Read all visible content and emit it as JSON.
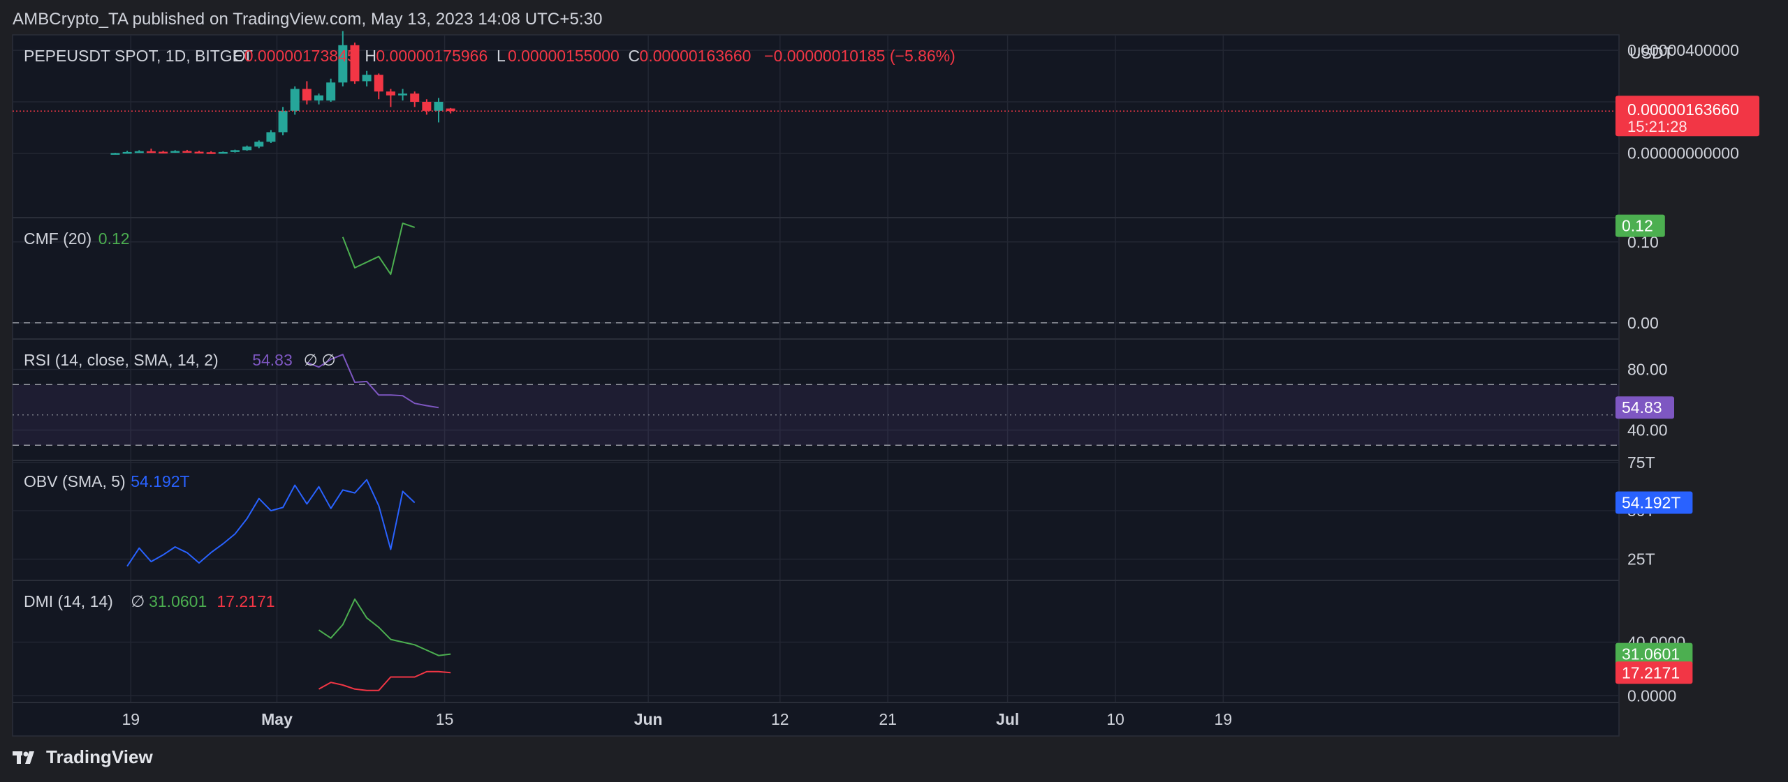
{
  "header": {
    "published_by": "AMBCrypto_TA published on TradingView.com, May 13, 2023 14:08 UTC+5:30"
  },
  "footer": {
    "brand": "TradingView"
  },
  "colors": {
    "background": "#131722",
    "up": "#26a69a",
    "down": "#f23645",
    "cmf": "#4caf50",
    "rsi": "#7e57c2",
    "obv": "#2962ff",
    "dmi_plus": "#4caf50",
    "dmi_minus": "#f23645"
  },
  "chart_data": {
    "type": "line",
    "price_pane": {
      "legend_title": "PEPEUSDT SPOT, 1D, BITGET",
      "ohlc": [
        {
          "key": "O",
          "value": "0.00000173845"
        },
        {
          "key": "H",
          "value": "0.00000175966"
        },
        {
          "key": "L",
          "value": "0.00000155000"
        },
        {
          "key": "C",
          "value": "0.00000163660"
        }
      ],
      "change": "−0.00000010185 (−5.86%)",
      "axis_unit": "USDT",
      "tick_labels": [
        "0.00000400000",
        "0.00000200000",
        "0.00000000000"
      ],
      "last_price_label": "0.00000163660",
      "countdown_label": "15:21:28",
      "ylim": [
        -2.5e-06,
        4.6e-06
      ],
      "candles": [
        {
          "o": 0.0,
          "h": 2e-08,
          "l": 0.0,
          "c": 1e-08
        },
        {
          "o": 1e-08,
          "h": 1e-07,
          "l": 0.0,
          "c": 5e-08
        },
        {
          "o": 5e-08,
          "h": 1.2e-07,
          "l": 4e-08,
          "c": 8e-08
        },
        {
          "o": 8e-08,
          "h": 1.8e-07,
          "l": 5e-08,
          "c": 6e-08
        },
        {
          "o": 6e-08,
          "h": 1e-07,
          "l": 2e-08,
          "c": 3e-08
        },
        {
          "o": 3e-08,
          "h": 1.2e-07,
          "l": 2e-08,
          "c": 9e-08
        },
        {
          "o": 9e-08,
          "h": 1.3e-07,
          "l": 4e-08,
          "c": 6e-08
        },
        {
          "o": 6e-08,
          "h": 1e-07,
          "l": 3e-08,
          "c": 4e-08
        },
        {
          "o": 4e-08,
          "h": 8e-08,
          "l": 1e-08,
          "c": 3e-08
        },
        {
          "o": 3e-08,
          "h": 7e-08,
          "l": 1e-08,
          "c": 5e-08
        },
        {
          "o": 5e-08,
          "h": 1.4e-07,
          "l": 3e-08,
          "c": 1.2e-07
        },
        {
          "o": 1.2e-07,
          "h": 3e-07,
          "l": 1e-07,
          "c": 2.6e-07
        },
        {
          "o": 2.6e-07,
          "h": 5e-07,
          "l": 2e-07,
          "c": 4.5e-07
        },
        {
          "o": 4.5e-07,
          "h": 9e-07,
          "l": 4e-07,
          "c": 8.2e-07
        },
        {
          "o": 8.2e-07,
          "h": 1.8e-06,
          "l": 7e-07,
          "c": 1.65e-06
        },
        {
          "o": 1.65e-06,
          "h": 2.6e-06,
          "l": 1.5e-06,
          "c": 2.5e-06
        },
        {
          "o": 2.5e-06,
          "h": 2.8e-06,
          "l": 1.9e-06,
          "c": 2.05e-06
        },
        {
          "o": 2.05e-06,
          "h": 2.32e-06,
          "l": 1.9e-06,
          "c": 2.25e-06
        },
        {
          "o": 2.05e-06,
          "h": 2.9e-06,
          "l": 2e-06,
          "c": 2.75e-06
        },
        {
          "o": 2.75e-06,
          "h": 4.75e-06,
          "l": 2.6e-06,
          "c": 4.2e-06
        },
        {
          "o": 4.2e-06,
          "h": 4.3e-06,
          "l": 2.7e-06,
          "c": 2.8e-06
        },
        {
          "o": 2.8e-06,
          "h": 3.2e-06,
          "l": 2.6e-06,
          "c": 3.05e-06
        },
        {
          "o": 3.05e-06,
          "h": 3.1e-06,
          "l": 2.1e-06,
          "c": 2.4e-06
        },
        {
          "o": 2.4e-06,
          "h": 2.5e-06,
          "l": 1.8e-06,
          "c": 2.25e-06
        },
        {
          "o": 2.25e-06,
          "h": 2.5e-06,
          "l": 2.05e-06,
          "c": 2.32e-06
        },
        {
          "o": 2.32e-06,
          "h": 2.4e-06,
          "l": 1.8e-06,
          "c": 2e-06
        },
        {
          "o": 2e-06,
          "h": 2.1e-06,
          "l": 1.5e-06,
          "c": 1.65e-06
        },
        {
          "o": 1.65e-06,
          "h": 2.15e-06,
          "l": 1.2e-06,
          "c": 2e-06
        },
        {
          "o": 1.74e-06,
          "h": 1.76e-06,
          "l": 1.55e-06,
          "c": 1.64e-06
        }
      ]
    },
    "x_axis": {
      "tick_labels": [
        {
          "label": "19",
          "index": 1.3,
          "bold": false
        },
        {
          "label": "May",
          "index": 13.5,
          "bold": true
        },
        {
          "label": "15",
          "index": 27.5,
          "bold": false
        },
        {
          "label": "Jun",
          "index": 44.5,
          "bold": true
        },
        {
          "label": "12",
          "index": 55.5,
          "bold": false
        },
        {
          "label": "21",
          "index": 64.5,
          "bold": false
        },
        {
          "label": "Jul",
          "index": 74.5,
          "bold": true
        },
        {
          "label": "10",
          "index": 83.5,
          "bold": false
        },
        {
          "label": "19",
          "index": 92.5,
          "bold": false
        }
      ]
    },
    "indicators": [
      {
        "id": "cmf",
        "legend_title": "CMF (20)",
        "legend_values": [
          "0.12"
        ],
        "tick_labels": [
          {
            "label": "0.10",
            "value": 0.1
          },
          {
            "label": "0.00",
            "value": 0.0
          }
        ],
        "dashed_levels": [
          0.0
        ],
        "ylim": [
          -0.02,
          0.13
        ],
        "value_badges": [
          {
            "label": "0.12",
            "value": 0.12,
            "series": "cmf"
          }
        ],
        "series": [
          {
            "name": "cmf",
            "start_index": 19,
            "values": [
              0.106,
              0.068,
              0.075,
              0.082,
              0.06,
              0.123,
              0.118
            ]
          }
        ]
      },
      {
        "id": "rsi",
        "legend_title": "RSI (14, close, SMA, 14, 2)",
        "legend_values": [
          "54.83",
          "∅",
          "∅"
        ],
        "tick_labels": [
          {
            "label": "80.00",
            "value": 80
          },
          {
            "label": "40.00",
            "value": 40
          }
        ],
        "dashed_levels": [
          70,
          30
        ],
        "dotted_levels": [
          50
        ],
        "band": [
          30,
          70
        ],
        "ylim": [
          20,
          100
        ],
        "value_badges": [
          {
            "label": "54.83",
            "value": 54.83,
            "series": "rsi"
          }
        ],
        "series": [
          {
            "name": "rsi",
            "start_index": 16,
            "values": [
              84.5,
              81.5,
              86.6,
              89.8,
              71.5,
              72.0,
              63.1,
              63.1,
              62.6,
              57.6,
              56.1,
              54.8
            ]
          }
        ]
      },
      {
        "id": "obv",
        "legend_title": "OBV (SMA, 5)",
        "legend_values": [
          "54.192T"
        ],
        "tick_labels": [
          {
            "label": "75T",
            "value": 75
          },
          {
            "label": "50T",
            "value": 50
          },
          {
            "label": "25T",
            "value": 25
          }
        ],
        "ylim": [
          14,
          76
        ],
        "value_badges": [
          {
            "label": "54.192T",
            "value": 54.192,
            "series": "obv"
          }
        ],
        "series": [
          {
            "name": "obv",
            "start_index": 1,
            "values": [
              21.3,
              30.7,
              23.7,
              27.2,
              31.3,
              28.3,
              23.0,
              28.4,
              32.9,
              38.0,
              45.9,
              56.3,
              50.0,
              51.7,
              63.2,
              53.5,
              62.4,
              51.2,
              60.7,
              59.2,
              66.0,
              52.6,
              30.0,
              60.0,
              54.2
            ]
          }
        ]
      },
      {
        "id": "dmi",
        "legend_title": "DMI (14, 14)",
        "legend_values": [
          "∅",
          "31.0601",
          "17.2171"
        ],
        "tick_labels": [
          {
            "label": "40.0000",
            "value": 40
          },
          {
            "label": "0.0000",
            "value": 0
          }
        ],
        "ylim": [
          -5,
          86
        ],
        "value_badges": [
          {
            "label": "31.0601",
            "value": 31.06,
            "series": "plus_di"
          },
          {
            "label": "17.2171",
            "value": 17.22,
            "series": "minus_di"
          }
        ],
        "series": [
          {
            "name": "plus_di",
            "start_index": 17,
            "values": [
              49.0,
              43.0,
              53.0,
              72.0,
              58.0,
              51.0,
              42.0,
              40.0,
              38.0,
              34.0,
              30.0,
              31.1
            ]
          },
          {
            "name": "minus_di",
            "start_index": 17,
            "values": [
              5.0,
              10.0,
              8.0,
              5.0,
              4.0,
              4.0,
              14.0,
              14.0,
              14.0,
              18.0,
              18.0,
              17.2
            ]
          }
        ]
      }
    ]
  }
}
